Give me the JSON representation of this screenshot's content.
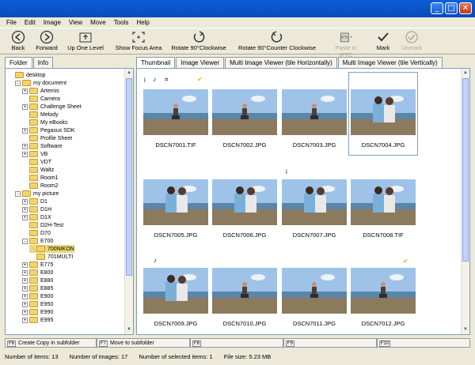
{
  "window": {
    "minimize": "_",
    "maximize": "□",
    "close": "✕"
  },
  "menu": [
    "File",
    "Edit",
    "Image",
    "View",
    "Move",
    "Tools",
    "Help"
  ],
  "toolbar": {
    "back": "Back",
    "forward": "Forward",
    "up": "Up One Level",
    "focus": "Show Focus Area",
    "rot_cw": "Rotate 90°Clockwise",
    "rot_ccw": "Rotate 90°Counter Clockwise",
    "paste_iptc": "Paste in IPTC",
    "mark": "Mark",
    "unmark": "Unmark"
  },
  "left_tabs": [
    "Folder",
    "Info"
  ],
  "tree": [
    {
      "label": "desktop",
      "level": 0,
      "exp": ""
    },
    {
      "label": "my document",
      "level": 1,
      "exp": "-"
    },
    {
      "label": "Artemis",
      "level": 2,
      "exp": "+"
    },
    {
      "label": "Camera",
      "level": 2,
      "exp": ""
    },
    {
      "label": "Challenge Sheet",
      "level": 2,
      "exp": "+"
    },
    {
      "label": "Melody",
      "level": 2,
      "exp": ""
    },
    {
      "label": "My eBooks",
      "level": 2,
      "exp": ""
    },
    {
      "label": "Pegasus SDK",
      "level": 2,
      "exp": "+"
    },
    {
      "label": "Profile Sheet",
      "level": 2,
      "exp": ""
    },
    {
      "label": "Software",
      "level": 2,
      "exp": "+"
    },
    {
      "label": "VB",
      "level": 2,
      "exp": "+"
    },
    {
      "label": "VDT",
      "level": 2,
      "exp": ""
    },
    {
      "label": "Waltz",
      "level": 2,
      "exp": ""
    },
    {
      "label": "Room1",
      "level": 2,
      "exp": ""
    },
    {
      "label": "Room2",
      "level": 2,
      "exp": ""
    },
    {
      "label": "my picture",
      "level": 1,
      "exp": "-"
    },
    {
      "label": "D1",
      "level": 2,
      "exp": "+"
    },
    {
      "label": "D1H",
      "level": 2,
      "exp": "+"
    },
    {
      "label": "D1X",
      "level": 2,
      "exp": "+"
    },
    {
      "label": "D2H-Test",
      "level": 2,
      "exp": ""
    },
    {
      "label": "D70",
      "level": 2,
      "exp": ""
    },
    {
      "label": "E700",
      "level": 2,
      "exp": "-"
    },
    {
      "label": "700NIKON",
      "level": 3,
      "exp": "",
      "sel": true
    },
    {
      "label": "701MULTI",
      "level": 3,
      "exp": ""
    },
    {
      "label": "E775",
      "level": 2,
      "exp": "+"
    },
    {
      "label": "E800",
      "level": 2,
      "exp": "+"
    },
    {
      "label": "E880",
      "level": 2,
      "exp": "+"
    },
    {
      "label": "E885",
      "level": 2,
      "exp": "+"
    },
    {
      "label": "E900",
      "level": 2,
      "exp": "+"
    },
    {
      "label": "E950",
      "level": 2,
      "exp": "+"
    },
    {
      "label": "E990",
      "level": 2,
      "exp": "+"
    },
    {
      "label": "E995",
      "level": 2,
      "exp": "+"
    }
  ],
  "view_tabs": [
    "Thumbnail",
    "Image Viewer",
    "Multi Image Viewer (tile Horizontally)",
    "Multi Image Viewer (tile Vertically)"
  ],
  "thumbs": [
    {
      "name": "DSCN7001.TIF",
      "kind": "man"
    },
    {
      "name": "DSCN7002.JPG",
      "kind": "man"
    },
    {
      "name": "DSCN7003.JPG",
      "kind": "man"
    },
    {
      "name": "DSCN7004.JPG",
      "kind": "couple"
    },
    {
      "name": "DSCN7005.JPG",
      "kind": "couple"
    },
    {
      "name": "DSCN7006.JPG",
      "kind": "couple"
    },
    {
      "name": "DSCN7007.JPG",
      "kind": "couple"
    },
    {
      "name": "DSCN7008.TIF",
      "kind": "couple"
    },
    {
      "name": "DSCN7009.JPG",
      "kind": "couple"
    },
    {
      "name": "DSCN7010.JPG",
      "kind": "man"
    },
    {
      "name": "DSCN7011.JPG",
      "kind": "man"
    },
    {
      "name": "DSCN7012.JPG",
      "kind": "man"
    }
  ],
  "meta_icons": {
    "info": "i",
    "music": "♪",
    "hash": "⌗",
    "check": "✔"
  },
  "fkeys": [
    {
      "key": "F6",
      "label": "Create Copy in subfolder"
    },
    {
      "key": "F7",
      "label": "Move to subfolder"
    },
    {
      "key": "F8",
      "label": ""
    },
    {
      "key": "F9",
      "label": ""
    },
    {
      "key": "F10",
      "label": ""
    }
  ],
  "status": {
    "items": "Number of items:  13",
    "images": "Number of images:  17",
    "selected": "Number of selected items:  1",
    "filesize": "File size:  5.23 MB"
  },
  "colors": {
    "sky": "#9fc3e8",
    "sea": "#5c86a8",
    "sand": "#8c7a5e",
    "accent": "#e0b020"
  }
}
